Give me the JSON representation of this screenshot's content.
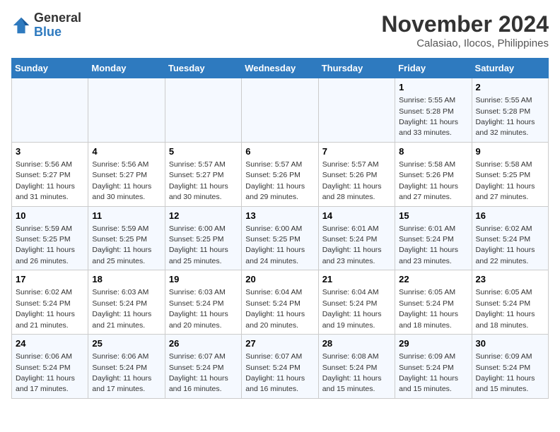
{
  "header": {
    "logo_general": "General",
    "logo_blue": "Blue",
    "month_year": "November 2024",
    "location": "Calasiao, Ilocos, Philippines"
  },
  "weekdays": [
    "Sunday",
    "Monday",
    "Tuesday",
    "Wednesday",
    "Thursday",
    "Friday",
    "Saturday"
  ],
  "weeks": [
    [
      {
        "day": "",
        "detail": ""
      },
      {
        "day": "",
        "detail": ""
      },
      {
        "day": "",
        "detail": ""
      },
      {
        "day": "",
        "detail": ""
      },
      {
        "day": "",
        "detail": ""
      },
      {
        "day": "1",
        "detail": "Sunrise: 5:55 AM\nSunset: 5:28 PM\nDaylight: 11 hours and 33 minutes."
      },
      {
        "day": "2",
        "detail": "Sunrise: 5:55 AM\nSunset: 5:28 PM\nDaylight: 11 hours and 32 minutes."
      }
    ],
    [
      {
        "day": "3",
        "detail": "Sunrise: 5:56 AM\nSunset: 5:27 PM\nDaylight: 11 hours and 31 minutes."
      },
      {
        "day": "4",
        "detail": "Sunrise: 5:56 AM\nSunset: 5:27 PM\nDaylight: 11 hours and 30 minutes."
      },
      {
        "day": "5",
        "detail": "Sunrise: 5:57 AM\nSunset: 5:27 PM\nDaylight: 11 hours and 30 minutes."
      },
      {
        "day": "6",
        "detail": "Sunrise: 5:57 AM\nSunset: 5:26 PM\nDaylight: 11 hours and 29 minutes."
      },
      {
        "day": "7",
        "detail": "Sunrise: 5:57 AM\nSunset: 5:26 PM\nDaylight: 11 hours and 28 minutes."
      },
      {
        "day": "8",
        "detail": "Sunrise: 5:58 AM\nSunset: 5:26 PM\nDaylight: 11 hours and 27 minutes."
      },
      {
        "day": "9",
        "detail": "Sunrise: 5:58 AM\nSunset: 5:25 PM\nDaylight: 11 hours and 27 minutes."
      }
    ],
    [
      {
        "day": "10",
        "detail": "Sunrise: 5:59 AM\nSunset: 5:25 PM\nDaylight: 11 hours and 26 minutes."
      },
      {
        "day": "11",
        "detail": "Sunrise: 5:59 AM\nSunset: 5:25 PM\nDaylight: 11 hours and 25 minutes."
      },
      {
        "day": "12",
        "detail": "Sunrise: 6:00 AM\nSunset: 5:25 PM\nDaylight: 11 hours and 25 minutes."
      },
      {
        "day": "13",
        "detail": "Sunrise: 6:00 AM\nSunset: 5:25 PM\nDaylight: 11 hours and 24 minutes."
      },
      {
        "day": "14",
        "detail": "Sunrise: 6:01 AM\nSunset: 5:24 PM\nDaylight: 11 hours and 23 minutes."
      },
      {
        "day": "15",
        "detail": "Sunrise: 6:01 AM\nSunset: 5:24 PM\nDaylight: 11 hours and 23 minutes."
      },
      {
        "day": "16",
        "detail": "Sunrise: 6:02 AM\nSunset: 5:24 PM\nDaylight: 11 hours and 22 minutes."
      }
    ],
    [
      {
        "day": "17",
        "detail": "Sunrise: 6:02 AM\nSunset: 5:24 PM\nDaylight: 11 hours and 21 minutes."
      },
      {
        "day": "18",
        "detail": "Sunrise: 6:03 AM\nSunset: 5:24 PM\nDaylight: 11 hours and 21 minutes."
      },
      {
        "day": "19",
        "detail": "Sunrise: 6:03 AM\nSunset: 5:24 PM\nDaylight: 11 hours and 20 minutes."
      },
      {
        "day": "20",
        "detail": "Sunrise: 6:04 AM\nSunset: 5:24 PM\nDaylight: 11 hours and 20 minutes."
      },
      {
        "day": "21",
        "detail": "Sunrise: 6:04 AM\nSunset: 5:24 PM\nDaylight: 11 hours and 19 minutes."
      },
      {
        "day": "22",
        "detail": "Sunrise: 6:05 AM\nSunset: 5:24 PM\nDaylight: 11 hours and 18 minutes."
      },
      {
        "day": "23",
        "detail": "Sunrise: 6:05 AM\nSunset: 5:24 PM\nDaylight: 11 hours and 18 minutes."
      }
    ],
    [
      {
        "day": "24",
        "detail": "Sunrise: 6:06 AM\nSunset: 5:24 PM\nDaylight: 11 hours and 17 minutes."
      },
      {
        "day": "25",
        "detail": "Sunrise: 6:06 AM\nSunset: 5:24 PM\nDaylight: 11 hours and 17 minutes."
      },
      {
        "day": "26",
        "detail": "Sunrise: 6:07 AM\nSunset: 5:24 PM\nDaylight: 11 hours and 16 minutes."
      },
      {
        "day": "27",
        "detail": "Sunrise: 6:07 AM\nSunset: 5:24 PM\nDaylight: 11 hours and 16 minutes."
      },
      {
        "day": "28",
        "detail": "Sunrise: 6:08 AM\nSunset: 5:24 PM\nDaylight: 11 hours and 15 minutes."
      },
      {
        "day": "29",
        "detail": "Sunrise: 6:09 AM\nSunset: 5:24 PM\nDaylight: 11 hours and 15 minutes."
      },
      {
        "day": "30",
        "detail": "Sunrise: 6:09 AM\nSunset: 5:24 PM\nDaylight: 11 hours and 15 minutes."
      }
    ]
  ]
}
